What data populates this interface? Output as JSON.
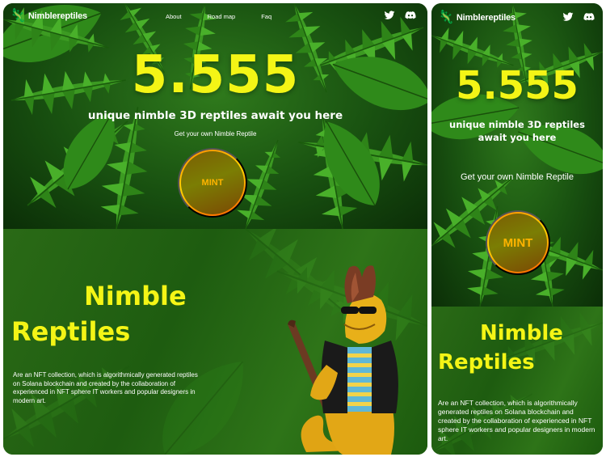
{
  "brand": {
    "logo_text": "Nimblereptiles",
    "accent": "#f4f516",
    "mint_gradient": [
      "#ff8a00",
      "#ffd400",
      "#ff5a00"
    ],
    "icons": [
      "chameleon-logo-icon",
      "twitter-icon",
      "discord-icon"
    ]
  },
  "nav": {
    "about": "About",
    "roadmap": "Road map",
    "faq": "Faq"
  },
  "hero": {
    "count": "5.555",
    "tagline": "unique nimble 3D reptiles await you here",
    "subtitle": "Get your own Nimble Reptile",
    "mint_label": "MINT"
  },
  "about": {
    "title_line1": "Nimble",
    "title_line2": "Reptiles",
    "description": "Are an NFT collection, which is algorithmically generated reptiles on Solana blockchain and created by the collaboration of experienced in NFT sphere IT workers and popular designers in modern art."
  }
}
